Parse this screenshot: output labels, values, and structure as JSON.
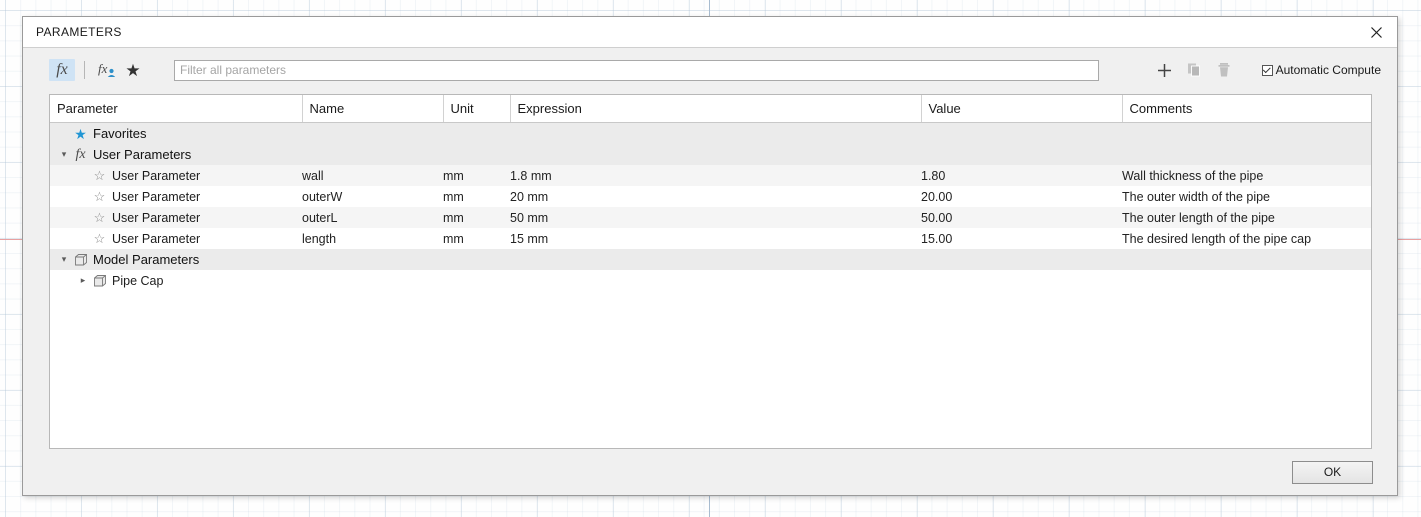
{
  "dialog": {
    "title": "PARAMETERS",
    "close_icon": "close-icon"
  },
  "toolbar": {
    "fx_user_param_icon": "fx-icon",
    "fx_model_param_icon": "fx-user-icon",
    "favorites_icon": "star-icon",
    "add_icon": "plus-icon",
    "duplicate_icon": "copy-icon",
    "delete_icon": "trash-icon",
    "automatic_compute_label": "Automatic Compute",
    "automatic_compute_checked": true
  },
  "filter": {
    "value": "",
    "placeholder": "Filter all parameters"
  },
  "table": {
    "columns": [
      {
        "key": "parameter",
        "label": "Parameter"
      },
      {
        "key": "name",
        "label": "Name"
      },
      {
        "key": "unit",
        "label": "Unit"
      },
      {
        "key": "expression",
        "label": "Expression"
      },
      {
        "key": "value",
        "label": "Value"
      },
      {
        "key": "comments",
        "label": "Comments"
      }
    ],
    "rows": [
      {
        "kind": "group",
        "icon": "star-icon-filled",
        "expander": "none",
        "parameter": "Favorites",
        "name": "",
        "unit": "",
        "expression": "",
        "value": "",
        "comments": ""
      },
      {
        "kind": "group",
        "icon": "fx-icon",
        "expander": "expanded",
        "parameter": "User Parameters",
        "name": "",
        "unit": "",
        "expression": "",
        "value": "",
        "comments": ""
      },
      {
        "kind": "data",
        "icon": "star-icon-outline",
        "expander": "none",
        "parameter": "User Parameter",
        "name": "wall",
        "unit": "mm",
        "expression": "1.8 mm",
        "value": "1.80",
        "comments": "Wall thickness of the pipe"
      },
      {
        "kind": "data",
        "icon": "star-icon-outline",
        "expander": "none",
        "parameter": "User Parameter",
        "name": "outerW",
        "unit": "mm",
        "expression": "20 mm",
        "value": "20.00",
        "comments": "The outer width of the pipe"
      },
      {
        "kind": "data",
        "icon": "star-icon-outline",
        "expander": "none",
        "parameter": "User Parameter",
        "name": "outerL",
        "unit": "mm",
        "expression": "50 mm",
        "value": "50.00",
        "comments": "The outer length of the pipe"
      },
      {
        "kind": "data",
        "icon": "star-icon-outline",
        "expander": "none",
        "parameter": "User Parameter",
        "name": "length",
        "unit": "mm",
        "expression": "15 mm",
        "value": "15.00",
        "comments": "The desired length of the pipe cap"
      },
      {
        "kind": "group",
        "icon": "cube-icon",
        "expander": "expanded",
        "parameter": "Model Parameters",
        "name": "",
        "unit": "",
        "expression": "",
        "value": "",
        "comments": ""
      },
      {
        "kind": "child",
        "icon": "cube-icon",
        "expander": "collapsed",
        "parameter": "Pipe Cap",
        "name": "",
        "unit": "",
        "expression": "",
        "value": "",
        "comments": ""
      }
    ]
  },
  "footer": {
    "ok_label": "OK"
  }
}
